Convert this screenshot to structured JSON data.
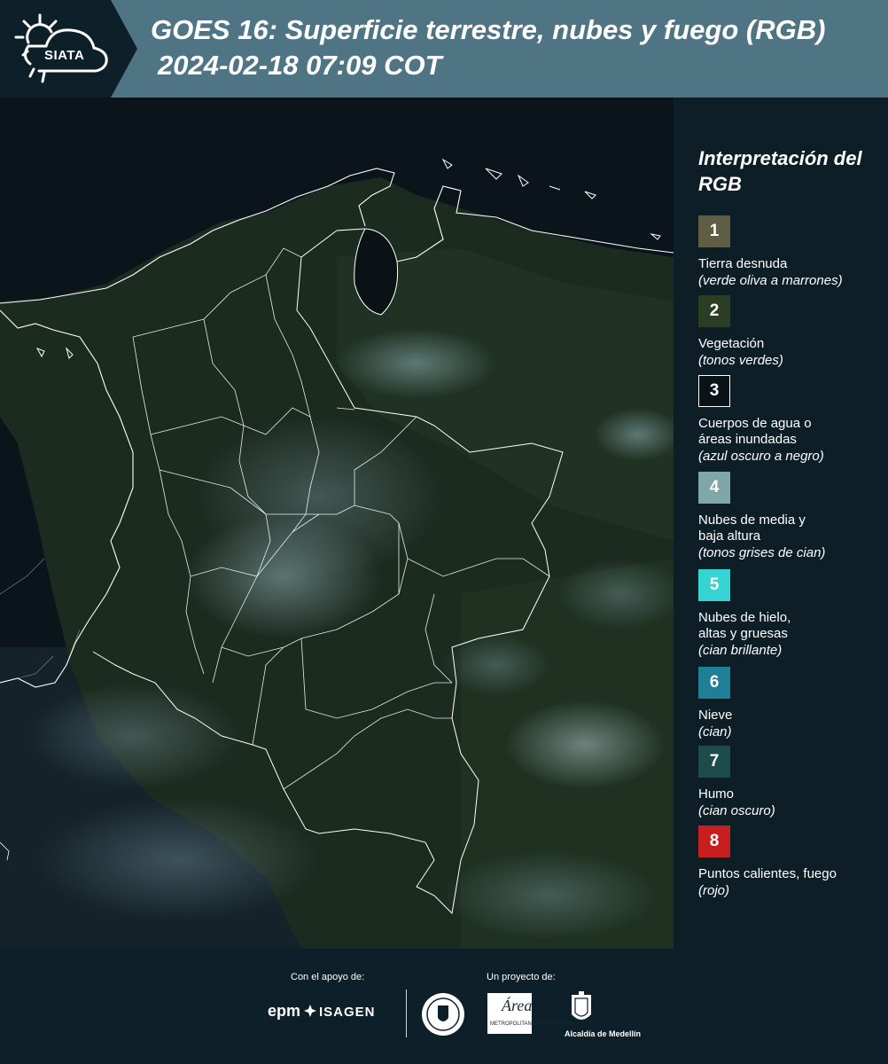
{
  "header": {
    "logo_text": "SIATA",
    "title_line1": "GOES 16: Superficie terrestre, nubes y fuego (RGB)",
    "title_line2": "2024-02-18 07:09 COT"
  },
  "legend": {
    "title": "Interpretación del RGB",
    "items": [
      {
        "number": "1",
        "label": "Tierra desnuda",
        "sub": "(verde oliva a marrones)",
        "color": "#5f5d44"
      },
      {
        "number": "2",
        "label": "Vegetación",
        "sub": "(tonos verdes)",
        "color": "#2b3d22"
      },
      {
        "number": "3",
        "label": "Cuerpos de agua o\náreas inundadas",
        "sub": "(azul oscuro a negro)",
        "color": "#0a1318"
      },
      {
        "number": "4",
        "label": "Nubes de media y\nbaja altura",
        "sub": "(tonos grises de cian)",
        "color": "#7fa7aa"
      },
      {
        "number": "5",
        "label": "Nubes de hielo,\naltas y gruesas",
        "sub": "(cian brillante)",
        "color": "#35d3d1"
      },
      {
        "number": "6",
        "label": "Nieve",
        "sub": "(cian)",
        "color": "#1f7f96"
      },
      {
        "number": "7",
        "label": "Humo",
        "sub": "(cian oscuro)",
        "color": "#1e4b4b"
      },
      {
        "number": "8",
        "label": "Puntos calientes, fuego",
        "sub": "(rojo)",
        "color": "#c61f1f"
      }
    ]
  },
  "footer": {
    "support_label": "Con el apoyo de:",
    "project_label": "Un proyecto de:",
    "epm": "epm",
    "isagen": "ISAGEN",
    "area_text": "Área",
    "area_sub": "METROPOLITANA Valle de Aburrá",
    "alcaldia": "Alcaldía de Medellín"
  }
}
